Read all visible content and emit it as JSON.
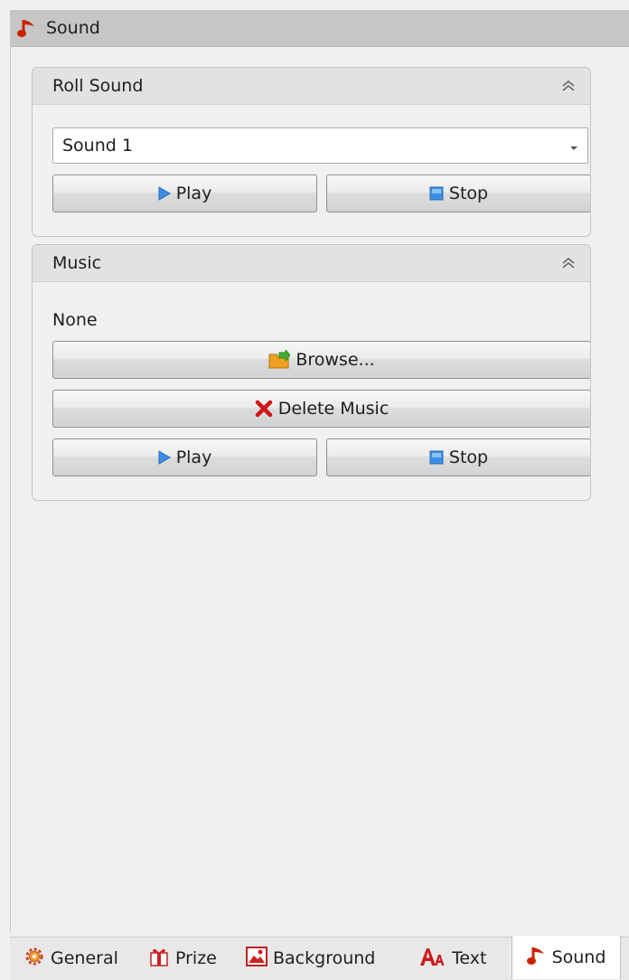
{
  "window": {
    "title": "Sound",
    "title_icon": "music-note-icon"
  },
  "roll_sound": {
    "title": "Roll Sound",
    "selected_sound": "Sound 1",
    "play_label": "Play",
    "stop_label": "Stop"
  },
  "music": {
    "title": "Music",
    "current_file": "None",
    "browse_label": "Browse...",
    "delete_label": "Delete Music",
    "play_label": "Play",
    "stop_label": "Stop"
  },
  "tabs": [
    {
      "label": "General",
      "icon": "gear-icon"
    },
    {
      "label": "Prize",
      "icon": "gift-icon"
    },
    {
      "label": "Background",
      "icon": "picture-icon"
    },
    {
      "label": "Text",
      "icon": "text-icon"
    },
    {
      "label": "Sound",
      "icon": "music-note-icon",
      "active": true
    }
  ],
  "colors": {
    "accent_red": "#cc2200",
    "play_blue": "#3a8ee6",
    "folder_orange": "#f0a020"
  }
}
